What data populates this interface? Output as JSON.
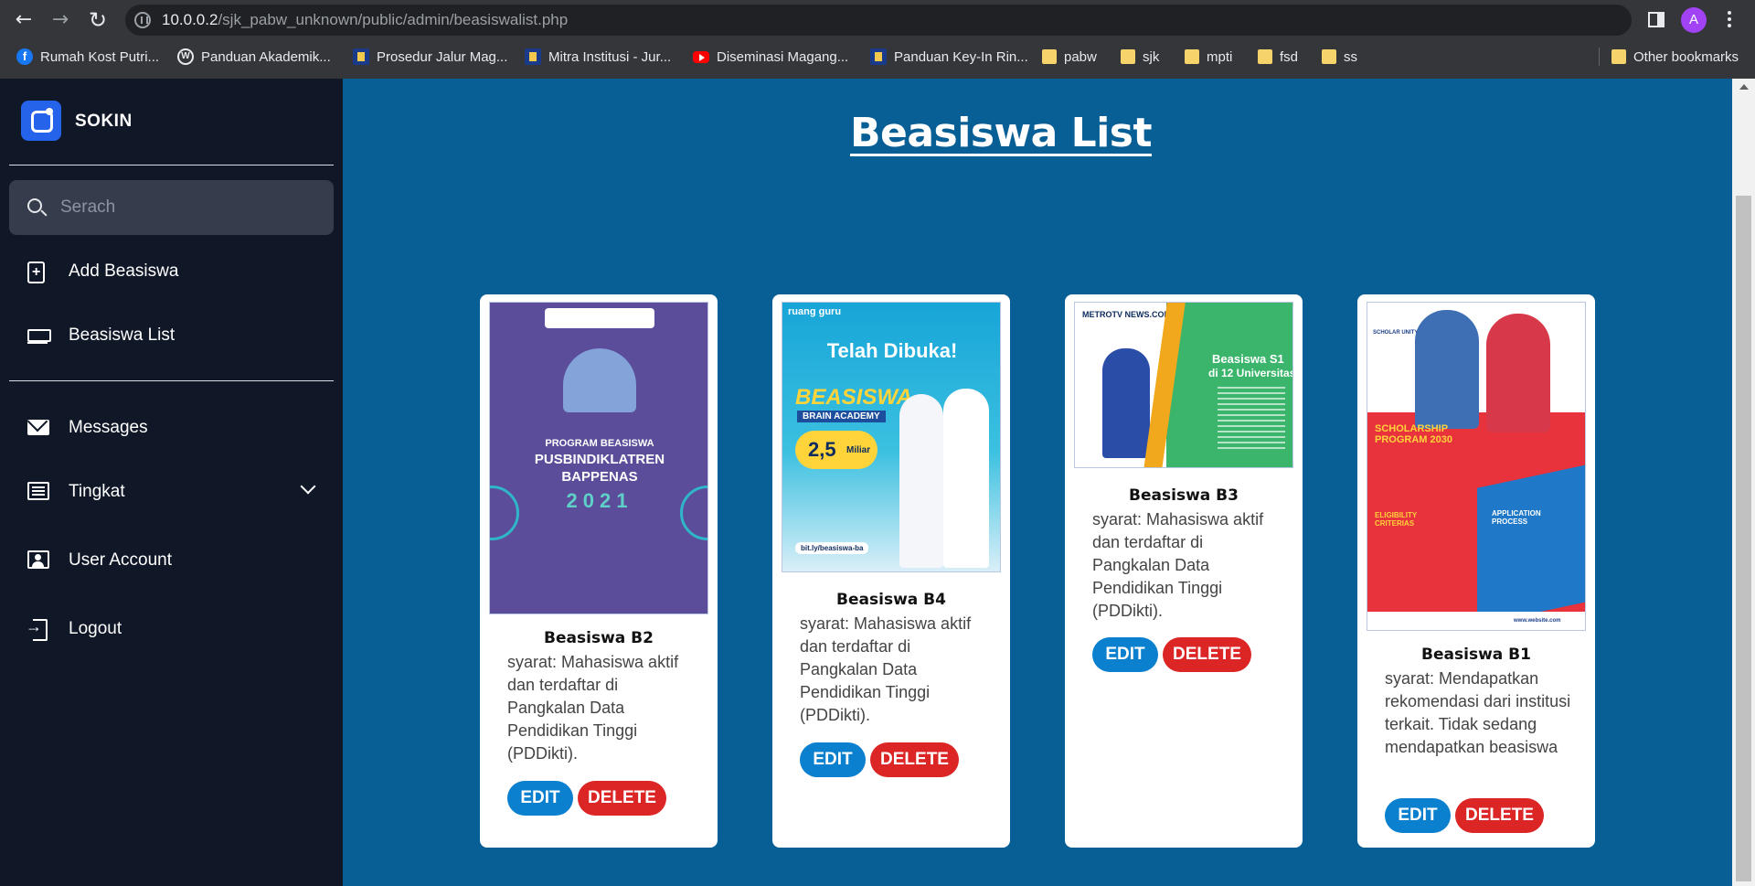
{
  "browser": {
    "url_host": "10.0.0.2",
    "url_path": "/sjk_pabw_unknown/public/admin/beasiswalist.php",
    "profile_initial": "A",
    "bookmarks": [
      {
        "label": "Rumah Kost Putri...",
        "icon": "facebook-icon"
      },
      {
        "label": "Panduan Akademik...",
        "icon": "wordpress-icon"
      },
      {
        "label": "Prosedur Jalur Mag...",
        "icon": "university-icon"
      },
      {
        "label": "Mitra Institusi - Jur...",
        "icon": "university-icon"
      },
      {
        "label": "Diseminasi Magang...",
        "icon": "youtube-icon"
      },
      {
        "label": "Panduan Key-In Rin...",
        "icon": "university-icon"
      },
      {
        "label": "pabw",
        "icon": "folder-icon"
      },
      {
        "label": "sjk",
        "icon": "folder-icon"
      },
      {
        "label": "mpti",
        "icon": "folder-icon"
      },
      {
        "label": "fsd",
        "icon": "folder-icon"
      },
      {
        "label": "ss",
        "icon": "folder-icon"
      }
    ],
    "other_bookmarks": "Other bookmarks"
  },
  "sidebar": {
    "brand": "SOKIN",
    "search_placeholder": "Serach",
    "items": [
      {
        "label": "Add Beasiswa",
        "icon": "add-file-icon"
      },
      {
        "label": "Beasiswa List",
        "icon": "list-icon"
      },
      {
        "label": "Messages",
        "icon": "mail-icon"
      },
      {
        "label": "Tingkat",
        "icon": "list-box-icon"
      },
      {
        "label": "User Account",
        "icon": "user-card-icon"
      },
      {
        "label": "Logout",
        "icon": "logout-icon"
      }
    ]
  },
  "main": {
    "title": "Beasiswa List",
    "edit_label": "EDIT",
    "delete_label": "DELETE",
    "cards": [
      {
        "title": "Beasiswa B2",
        "description": "syarat: Mahasiswa aktif dan terdaftar di Pangkalan Data Pendidikan Tinggi (PDDikti).",
        "poster": {
          "heading": "PROGRAM BEASISWA",
          "name": "PUSBINDIKLATREN",
          "org": "BAPPENAS",
          "year": "2021"
        }
      },
      {
        "title": "Beasiswa B4",
        "description": "syarat: Mahasiswa aktif dan terdaftar di Pangkalan Data Pendidikan Tinggi (PDDikti).",
        "poster": {
          "brand": "ruang guru",
          "headline": "Telah Dibuka!",
          "name": "BEASISWA",
          "sub": "BRAIN ACADEMY",
          "amount": "2,5",
          "amount_unit": "Miliar",
          "link": "bit.ly/beasiswa-ba"
        }
      },
      {
        "title": "Beasiswa B3",
        "description": "syarat: Mahasiswa aktif dan terdaftar di Pangkalan Data Pendidikan Tinggi (PDDikti).",
        "poster": {
          "brand": "METROTV NEWS.COM",
          "headline": "Beasiswa S1",
          "sub": "di 12 Universitas"
        }
      },
      {
        "title": "Beasiswa B1",
        "description": "syarat: Mendapatkan rekomendasi dari institusi terkait. Tidak sedang mendapatkan beasiswa",
        "poster": {
          "brand": "SCHOLAR UNITY",
          "headline": "SCHOLARSHIP PROGRAM 2030",
          "section1": "ELIGIBILITY CRITERIAS",
          "section2": "APPLICATION PROCESS",
          "site": "www.website.com"
        }
      }
    ]
  },
  "colors": {
    "page_bg": "#075f96",
    "sidebar_bg": "#101727",
    "edit_button": "#0b80cf",
    "delete_button": "#dc2626"
  }
}
